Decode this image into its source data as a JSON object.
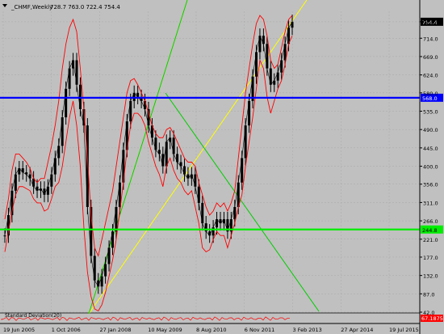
{
  "header": {
    "symbol_label": "_CHMF,Weekly",
    "ohlc_label": "728.7 763.0 722.4 754.4"
  },
  "indicator": {
    "label": "Standard Deviation(20)",
    "value_badge": "67.1875"
  },
  "colors": {
    "background": "#c0c0c0",
    "grid": "#a8a8a8",
    "candles": "#000000",
    "envelope": "#ff0000",
    "blue_level": "#0000ff",
    "green_level": "#00ee00",
    "fan_yellow": "#ffff00",
    "fan_green": "#00cc00",
    "price_badge_bg": "#000000",
    "price_badge_fg": "#ffffff"
  },
  "chart_data": {
    "type": "line",
    "timeframe": "Weekly",
    "ylim": [
      42.0,
      780.0
    ],
    "y_ticks": [
      "754.4",
      "714.0",
      "669.0",
      "624.0",
      "580.0",
      "535.0",
      "490.0",
      "445.0",
      "400.0",
      "356.0",
      "311.0",
      "266.0",
      "221.0",
      "177.0",
      "132.0",
      "87.0",
      "42.0"
    ],
    "x_ticks": [
      "19 Jun 2005",
      "1 Oct 2006",
      "27 Jan 2008",
      "10 May 2009",
      "8 Aug 2010",
      "6 Nov 2011",
      "3 Feb 2013",
      "27 Apr 2014",
      "19 Jul 2015"
    ],
    "last_price": 754.4,
    "horizontal_levels": [
      {
        "value": 568.0,
        "label": "568.0",
        "color": "blue"
      },
      {
        "value": 244.8,
        "label": "244.8",
        "color": "green"
      }
    ],
    "series": [
      {
        "name": "price",
        "values": [
          230,
          280,
          340,
          380,
          395,
          385,
          380,
          370,
          350,
          340,
          345,
          330,
          350,
          380,
          420,
          450,
          520,
          590,
          640,
          660,
          600,
          540,
          500,
          300,
          180,
          120,
          105,
          130,
          160,
          200,
          240,
          300,
          360,
          440,
          510,
          560,
          580,
          570,
          560,
          540,
          500,
          470,
          440,
          430,
          400,
          460,
          470,
          430,
          410,
          400,
          380,
          370,
          380,
          350,
          310,
          260,
          240,
          230,
          250,
          270,
          260,
          270,
          240,
          270,
          300,
          360,
          420,
          500,
          560,
          620,
          680,
          720,
          700,
          640,
          600,
          610,
          630,
          660,
          700,
          740,
          754
        ]
      },
      {
        "name": "upper_envelope",
        "values": [
          270,
          320,
          390,
          430,
          430,
          420,
          410,
          395,
          370,
          360,
          370,
          370,
          410,
          450,
          500,
          560,
          640,
          700,
          740,
          760,
          730,
          640,
          540,
          420,
          280,
          200,
          180,
          220,
          260,
          300,
          340,
          400,
          460,
          520,
          580,
          610,
          615,
          600,
          580,
          560,
          530,
          500,
          480,
          470,
          470,
          490,
          495,
          480,
          460,
          440,
          420,
          410,
          410,
          400,
          360,
          330,
          300,
          280,
          290,
          310,
          300,
          310,
          290,
          310,
          340,
          420,
          500,
          580,
          640,
          700,
          750,
          770,
          760,
          720,
          660,
          640,
          650,
          690,
          730,
          760,
          770
        ]
      },
      {
        "name": "lower_envelope",
        "values": [
          190,
          240,
          290,
          330,
          350,
          350,
          345,
          340,
          320,
          310,
          310,
          290,
          295,
          320,
          350,
          360,
          400,
          460,
          520,
          560,
          500,
          400,
          250,
          140,
          80,
          50,
          45,
          60,
          90,
          130,
          170,
          220,
          290,
          360,
          440,
          500,
          530,
          530,
          520,
          500,
          460,
          430,
          400,
          380,
          350,
          400,
          420,
          390,
          370,
          360,
          340,
          330,
          340,
          300,
          260,
          200,
          190,
          195,
          220,
          240,
          230,
          230,
          200,
          230,
          260,
          300,
          330,
          400,
          460,
          520,
          590,
          660,
          640,
          570,
          530,
          560,
          590,
          610,
          650,
          700,
          720
        ]
      }
    ]
  }
}
